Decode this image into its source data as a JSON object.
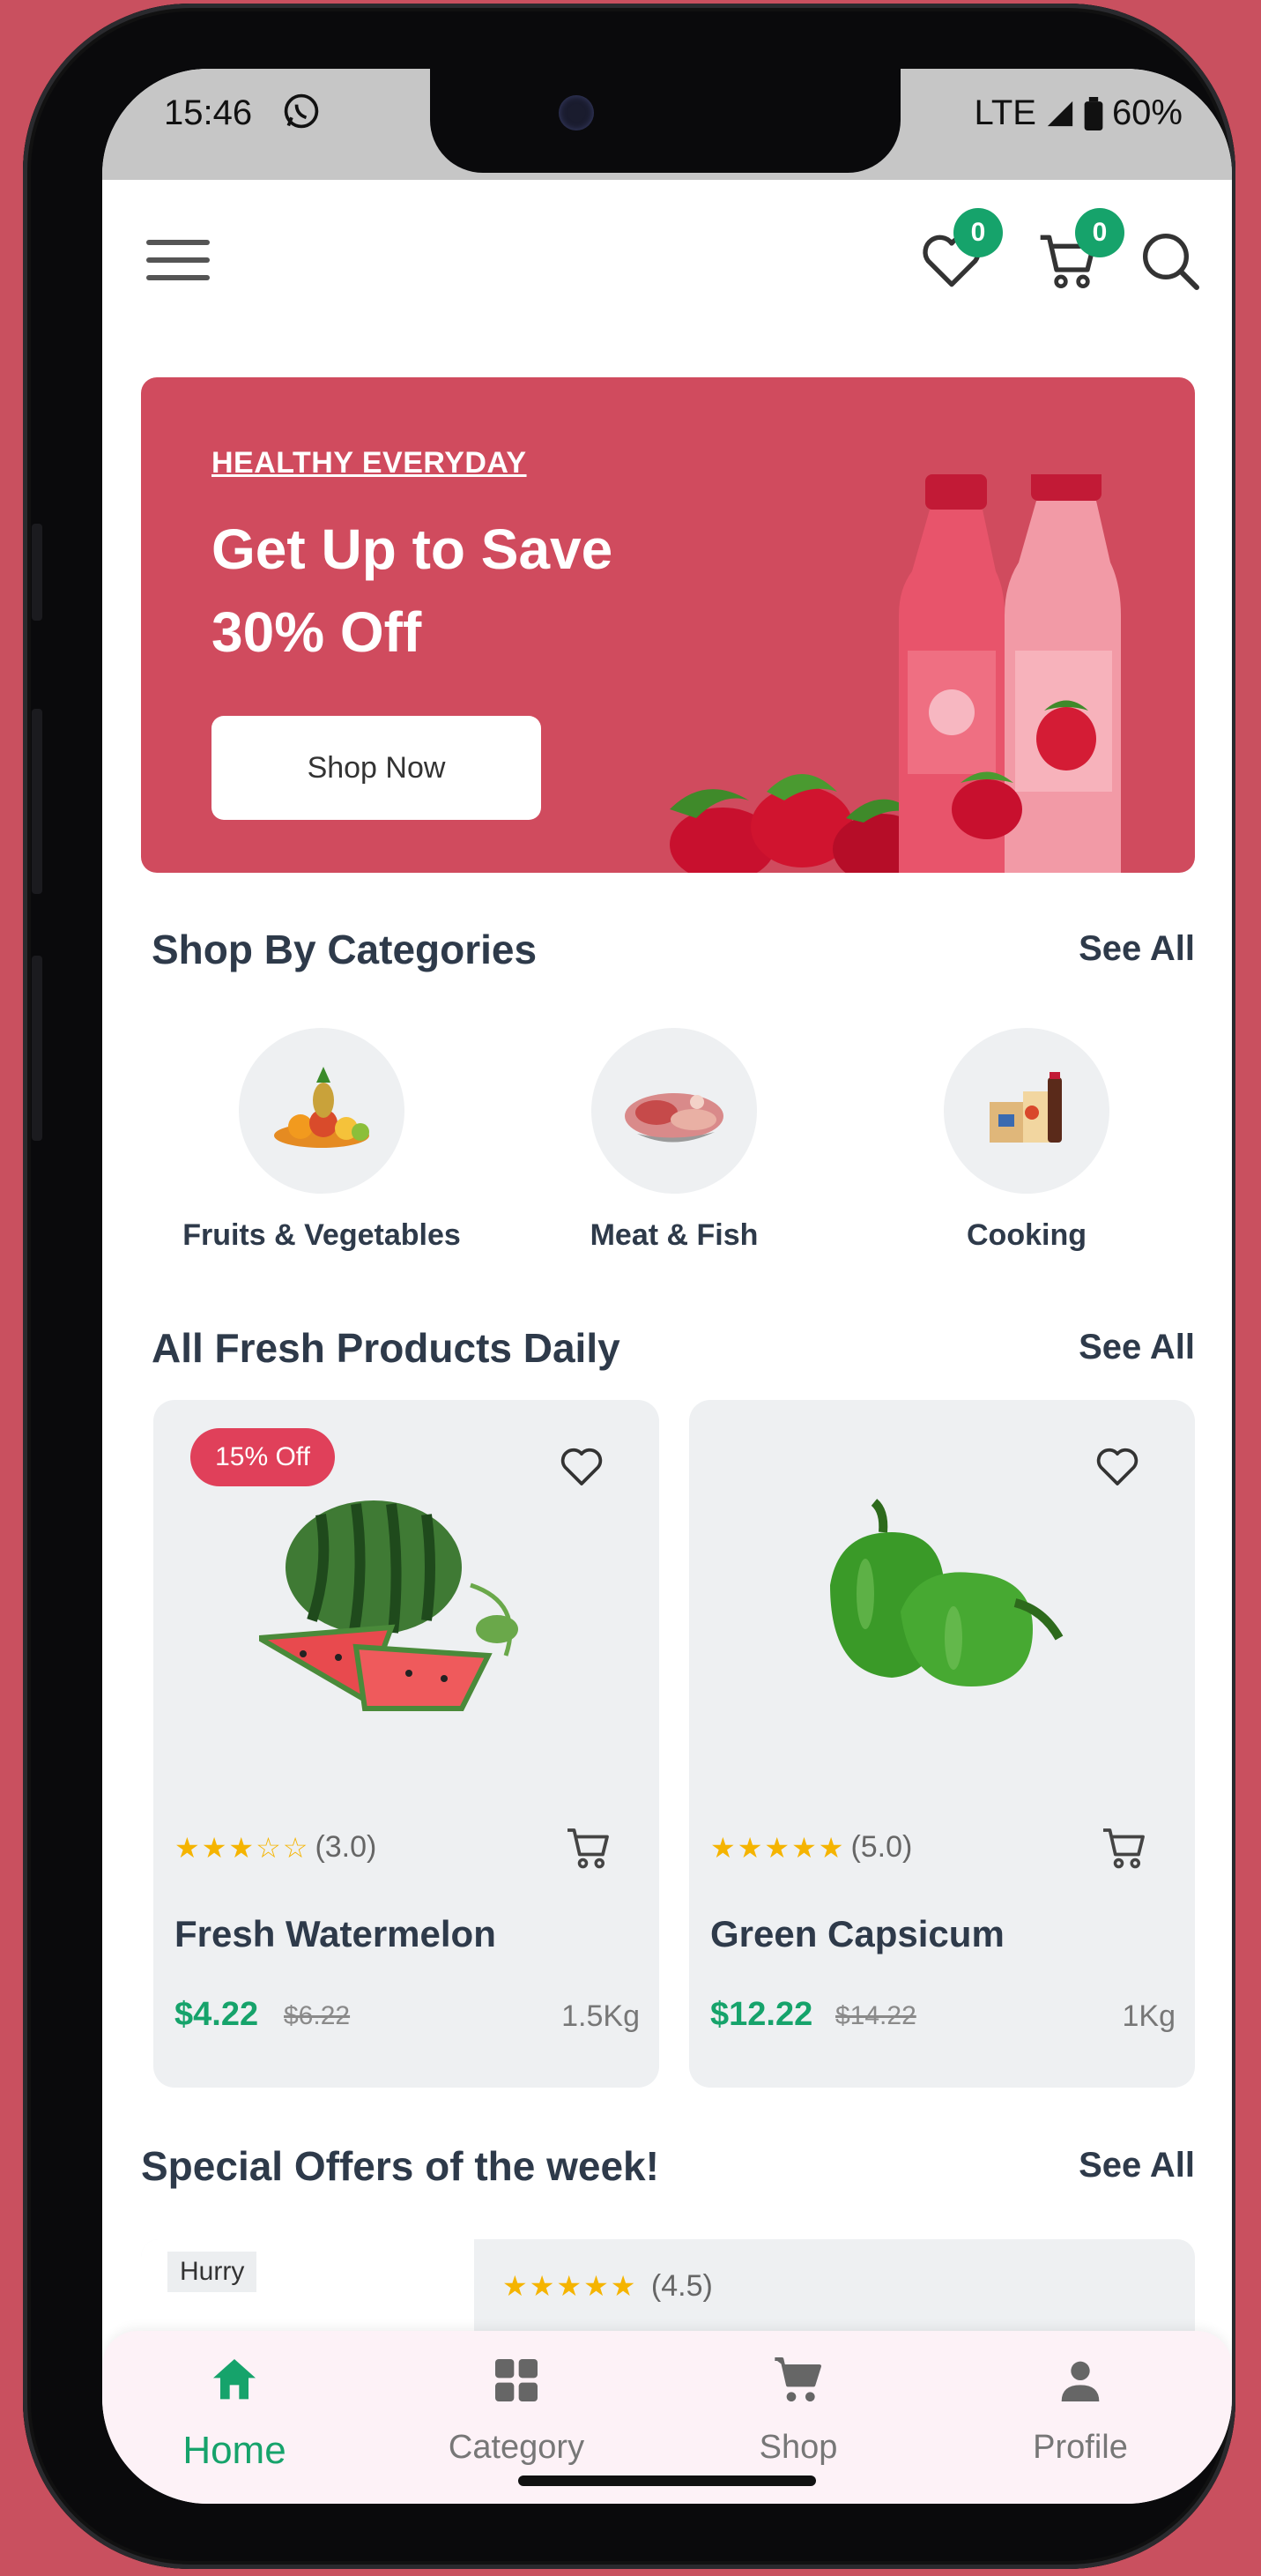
{
  "status_bar": {
    "time": "15:46",
    "network": "LTE",
    "battery": "60%"
  },
  "header": {
    "wishlist_count": "0",
    "cart_count": "0"
  },
  "banner": {
    "tag": "HEALTHY EVERYDAY",
    "title": "Get Up to Save 30% Off",
    "button": "Shop Now"
  },
  "categories_section": {
    "title": "Shop By Categories",
    "see_all": "See All",
    "items": [
      {
        "label": "Fruits & Vegetables",
        "icon": "fruits-vegetables-icon"
      },
      {
        "label": "Meat & Fish",
        "icon": "meat-fish-icon"
      },
      {
        "label": "Cooking",
        "icon": "cooking-icon"
      }
    ]
  },
  "products_section": {
    "title": "All Fresh Products Daily",
    "see_all": "See All",
    "products": [
      {
        "name": "Fresh Watermelon",
        "discount": "15% Off",
        "stars": "★★★☆☆",
        "rating": "(3.0)",
        "price": "$4.22",
        "old_price": "$6.22",
        "weight": "1.5Kg"
      },
      {
        "name": "Green Capsicum",
        "discount": "",
        "stars": "★★★★★",
        "rating": "(5.0)",
        "price": "$12.22",
        "old_price": "$14.22",
        "weight": "1Kg"
      }
    ]
  },
  "offers_section": {
    "title": "Special Offers of the week!",
    "see_all": "See All",
    "first": {
      "tag": "Hurry",
      "stars": "★★★★★",
      "rating": "(4.5)"
    }
  },
  "bottom_nav": [
    {
      "label": "Home",
      "icon": "home-icon",
      "active": true
    },
    {
      "label": "Category",
      "icon": "grid-icon",
      "active": false
    },
    {
      "label": "Shop",
      "icon": "cart-icon",
      "active": false
    },
    {
      "label": "Profile",
      "icon": "person-icon",
      "active": false
    }
  ],
  "colors": {
    "accent": "#16a36b",
    "banner": "#d04b5e",
    "badge": "#e0405a",
    "background": "#c9505f"
  }
}
